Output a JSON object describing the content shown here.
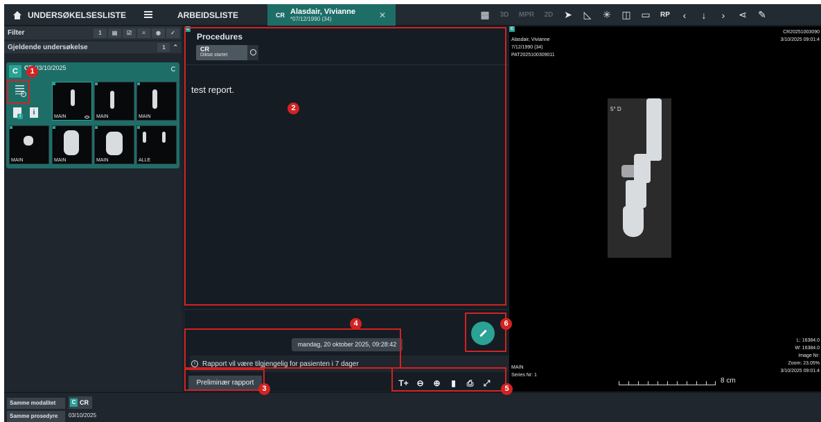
{
  "topbar": {
    "exam_list": "UNDERSØKELSESLISTE",
    "worklist": "ARBEIDSLISTE",
    "patient_tab": {
      "modality": "CR",
      "name": "Alasdair, Vivianne",
      "dob": "*07/12/1990 (34)"
    },
    "tools": [
      "3D",
      "MPR",
      "2D",
      "RP"
    ]
  },
  "left": {
    "filter_label": "Filter",
    "filter_count": "1",
    "current_label": "Gjeldende undersøkelse",
    "current_count": "1",
    "study": {
      "badge": "C",
      "modality": "CR",
      "date": "03/10/2025",
      "doc_badge": "1",
      "info": "i"
    },
    "thumbnails": [
      "MAIN",
      "MAIN",
      "MAIN",
      "MAIN",
      "MAIN",
      "MAIN",
      "ALLE"
    ]
  },
  "center": {
    "badge": "C",
    "procedures_title": "Procedures",
    "chip_code": "CR",
    "chip_status": "Diktat startet",
    "report_text": "test report.",
    "date_tooltip": "mandag, 20 oktober 2025, 09:28:42",
    "availability": "Rapport vil være tilgjengelig for pasienten i 7 dager",
    "prelim_button": "Preliminær rapport"
  },
  "viewer": {
    "badge": "C",
    "patient_name": "Alasdair, Vivianne",
    "dob": "7/12/1990 (34)",
    "patient_id": "PAT2025100309011",
    "accession": "CR20251003090",
    "datetime_top": "3/10/2025 09:01:4",
    "marker": "5° D",
    "series_label": "MAIN",
    "series_nr": "Series Nr: 1",
    "scale_label": "8 cm",
    "level": "L: 16384.0",
    "width": "W: 16384.0",
    "image_nr": "Image Nr:",
    "zoom": "Zoom: 23.05%",
    "datetime_bottom": "3/10/2025 09:01:4"
  },
  "bottom": {
    "same_modality": "Samme modalitet",
    "same_procedure": "Samme prosedyre",
    "chip_badge": "C",
    "chip_text": "CR",
    "date": "03/10/2025"
  },
  "callouts": [
    "1",
    "2",
    "3",
    "4",
    "5",
    "6"
  ],
  "colors": {
    "accent": "#2aa296",
    "tab": "#1e6e68",
    "callout": "#d32222"
  }
}
